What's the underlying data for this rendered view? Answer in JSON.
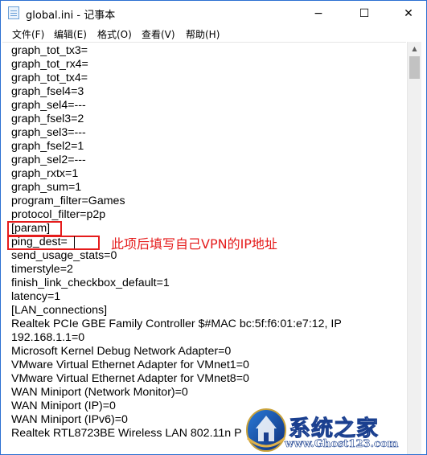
{
  "window": {
    "title": "global.ini - 记事本"
  },
  "title_buttons": {
    "minimize": "−",
    "maximize": "☐",
    "close": "✕"
  },
  "menu": [
    "文件(F)",
    "编辑(E)",
    "格式(O)",
    "查看(V)",
    "帮助(H)"
  ],
  "editor": {
    "lines": [
      "graph_tot_tx3=",
      "graph_tot_rx4=",
      "graph_tot_tx4=",
      "graph_fsel4=3",
      "graph_sel4=---",
      "graph_fsel3=2",
      "graph_sel3=---",
      "graph_fsel2=1",
      "graph_sel2=---",
      "graph_rxtx=1",
      "graph_sum=1",
      "program_filter=Games",
      "protocol_filter=p2p",
      "[param]",
      "ping_dest=",
      "send_usage_stats=0",
      "timerstyle=2",
      "finish_link_checkbox_default=1",
      "latency=1",
      "[LAN_connections]",
      "Realtek PCIe GBE Family Controller $#MAC bc:5f:f6:01:e7:12, IP",
      "192.168.1.1=0",
      "Microsoft Kernel Debug Network Adapter=0",
      "VMware Virtual Ethernet Adapter for VMnet1=0",
      "VMware Virtual Ethernet Adapter for VMnet8=0",
      "WAN Miniport (Network Monitor)=0",
      "WAN Miniport (IP)=0",
      "WAN Miniport (IPv6)=0",
      "Realtek RTL8723BE Wireless LAN 802.11n P"
    ]
  },
  "annotation": {
    "text": "此项后填写自己VPN的IP地址",
    "color": "#e51c1c"
  },
  "watermark": {
    "name": "系统之家",
    "url": "www.Ghost123.com"
  },
  "colors": {
    "window_border": "#2b6fd1",
    "highlight": "#e51c1c"
  }
}
